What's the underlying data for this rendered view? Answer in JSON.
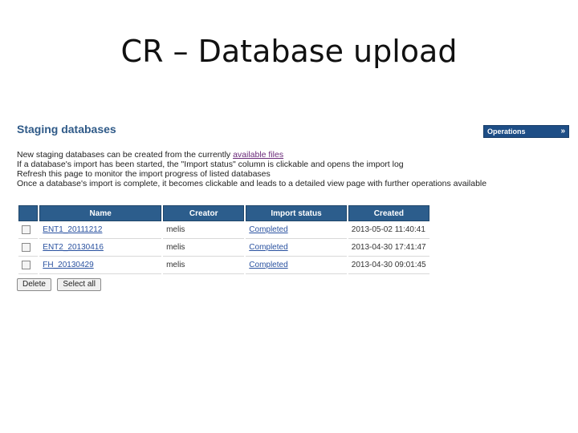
{
  "slide": {
    "title": "CR – Database upload"
  },
  "page": {
    "heading": "Staging databases",
    "operations_label": "Operations",
    "operations_chevron": "»",
    "info_lines": [
      {
        "prefix": "New staging databases can be created from the currently ",
        "link": "available files",
        "suffix": ""
      },
      {
        "prefix": "If a database's import has been started, the \"Import status\" column is clickable and opens the import log",
        "link": "",
        "suffix": ""
      },
      {
        "prefix": "Refresh this page to monitor the import progress of listed databases",
        "link": "",
        "suffix": ""
      },
      {
        "prefix": "Once a database's import is complete, it becomes clickable and leads to a detailed view page with further operations available",
        "link": "",
        "suffix": ""
      }
    ]
  },
  "table": {
    "columns": [
      "Name",
      "Creator",
      "Import status",
      "Created"
    ],
    "rows": [
      {
        "name": "ENT1_20111212",
        "creator": "melis",
        "status": "Completed",
        "created": "2013-05-02 11:40:41"
      },
      {
        "name": "ENT2_20130416",
        "creator": "melis",
        "status": "Completed",
        "created": "2013-04-30 17:41:47"
      },
      {
        "name": "FH_20130429",
        "creator": "melis",
        "status": "Completed",
        "created": "2013-04-30 09:01:45"
      }
    ]
  },
  "actions": {
    "delete_label": "Delete",
    "select_all_label": "Select all"
  }
}
